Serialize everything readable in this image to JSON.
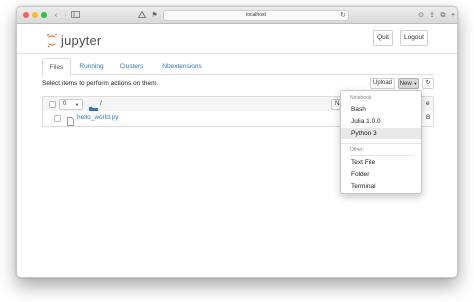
{
  "browser": {
    "address": "localhost",
    "reader_icon": "reader-icon",
    "share_icon": "share-icon"
  },
  "header": {
    "logo_text": "jupyter",
    "quit_label": "Quit",
    "logout_label": "Logout"
  },
  "tabs": [
    {
      "label": "Files",
      "active": true
    },
    {
      "label": "Running",
      "active": false
    },
    {
      "label": "Clusters",
      "active": false
    },
    {
      "label": "Nbextensions",
      "active": false
    }
  ],
  "toolbar": {
    "instructions": "Select items to perform actions on them.",
    "upload_label": "Upload",
    "new_label": "New",
    "refresh_icon": "refresh-icon"
  },
  "file_list": {
    "selected_count": "0",
    "path": "/",
    "sort_label": "Name",
    "size_header_fragment": "e",
    "files": [
      {
        "name": "hello_world.py",
        "size_fragment": "B"
      }
    ]
  },
  "new_menu": {
    "notebook_header": "Notebook:",
    "notebook_items": [
      "Bash",
      "Julia 1.0.0",
      "Python 3"
    ],
    "other_header": "Other:",
    "other_items": [
      "Text File",
      "Folder",
      "Terminal"
    ],
    "highlighted": "Python 3"
  },
  "colors": {
    "link": "#337ab7",
    "logo_orange": "#f37726"
  }
}
